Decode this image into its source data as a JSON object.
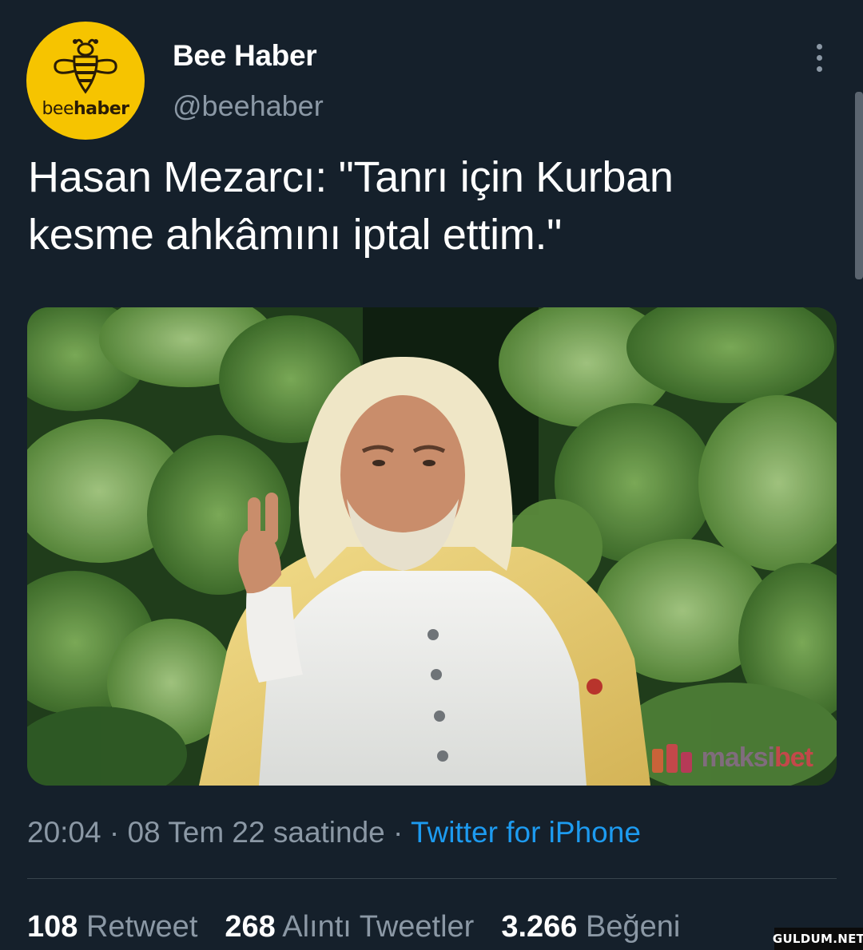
{
  "account": {
    "display_name": "Bee Haber",
    "handle": "@beehaber",
    "avatar_text_light": "bee",
    "avatar_text_bold": "haber",
    "avatar_color": "#f6c400"
  },
  "tweet": {
    "text_line1": "Hasan Mezarcı: \"Tanrı için Kurban",
    "text_line2": "kesme ahkâmını iptal ettim.\"",
    "watermark_icon_text": "m",
    "watermark_text_a": "maksi",
    "watermark_text_b": "bet"
  },
  "meta": {
    "time": "20:04",
    "sep1": " · ",
    "date": "08 Tem 22 saatinde",
    "sep2": " · ",
    "source": "Twitter for iPhone"
  },
  "stats": {
    "retweets_count": "108",
    "retweets_label": "Retweet",
    "quotes_count": "268",
    "quotes_label": "Alıntı Tweetler",
    "likes_count": "3.266",
    "likes_label": "Beğeni"
  },
  "site_badge": "GULDUM.NET",
  "theme": {
    "background": "#15202b",
    "secondary_text": "#8b98a5",
    "link": "#1d9bf0"
  }
}
